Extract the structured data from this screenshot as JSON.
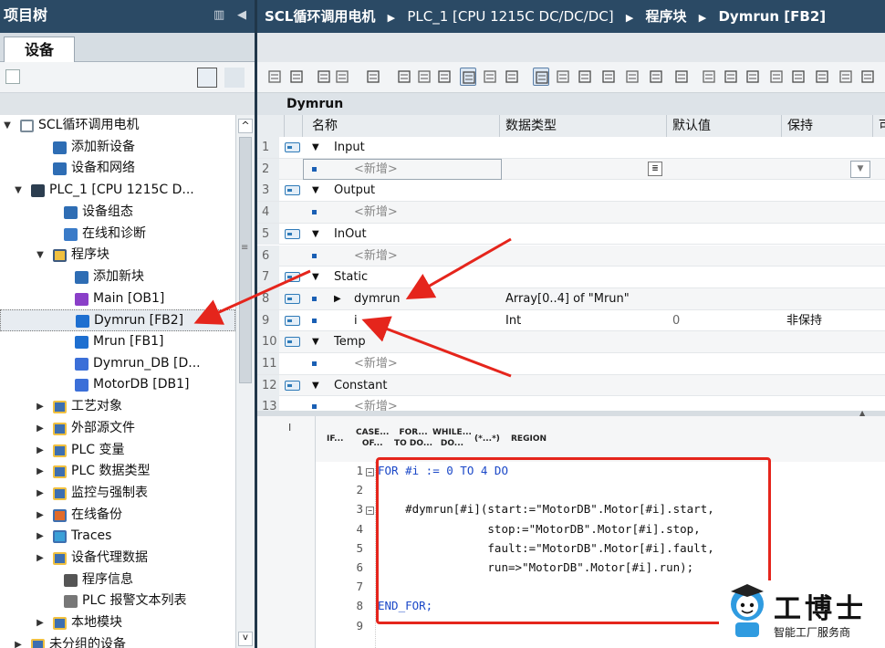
{
  "project_tree": {
    "title": "项目树",
    "tab": "设备",
    "items": [
      {
        "label": "SCL循环调用电机",
        "toggle": "▼"
      },
      {
        "label": "添加新设备",
        "toggle": ""
      },
      {
        "label": "设备和网络",
        "toggle": ""
      },
      {
        "label": "PLC_1 [CPU 1215C D...",
        "toggle": "▼"
      },
      {
        "label": "设备组态",
        "toggle": ""
      },
      {
        "label": "在线和诊断",
        "toggle": ""
      },
      {
        "label": "程序块",
        "toggle": "▼"
      },
      {
        "label": "添加新块",
        "toggle": ""
      },
      {
        "label": "Main [OB1]",
        "toggle": ""
      },
      {
        "label": "Dymrun [FB2]",
        "toggle": ""
      },
      {
        "label": "Mrun [FB1]",
        "toggle": ""
      },
      {
        "label": "Dymrun_DB [D...",
        "toggle": ""
      },
      {
        "label": "MotorDB [DB1]",
        "toggle": ""
      },
      {
        "label": "工艺对象",
        "toggle": "▶"
      },
      {
        "label": "外部源文件",
        "toggle": "▶"
      },
      {
        "label": "PLC 变量",
        "toggle": "▶"
      },
      {
        "label": "PLC 数据类型",
        "toggle": "▶"
      },
      {
        "label": "监控与强制表",
        "toggle": "▶"
      },
      {
        "label": "在线备份",
        "toggle": "▶"
      },
      {
        "label": "Traces",
        "toggle": "▶"
      },
      {
        "label": "设备代理数据",
        "toggle": "▶"
      },
      {
        "label": "程序信息",
        "toggle": ""
      },
      {
        "label": "PLC 报警文本列表",
        "toggle": ""
      },
      {
        "label": "本地模块",
        "toggle": "▶"
      },
      {
        "label": "未分组的设备",
        "toggle": "▶"
      }
    ]
  },
  "breadcrumb": [
    "SCL循环调用电机",
    "PLC_1 [CPU 1215C DC/DC/DC]",
    "程序块",
    "Dymrun [FB2]"
  ],
  "block_name": "Dymrun",
  "table": {
    "headers": [
      "名称",
      "数据类型",
      "默认值",
      "保持",
      "可"
    ],
    "rows": [
      {
        "n": "1",
        "name": "Input",
        "type": "",
        "default": "",
        "retain": "",
        "kind": "section"
      },
      {
        "n": "2",
        "name": "<新增>",
        "type": "",
        "default": "",
        "retain": "",
        "kind": "add"
      },
      {
        "n": "3",
        "name": "Output",
        "type": "",
        "default": "",
        "retain": "",
        "kind": "section"
      },
      {
        "n": "4",
        "name": "<新增>",
        "type": "",
        "default": "",
        "retain": "",
        "kind": "add"
      },
      {
        "n": "5",
        "name": "InOut",
        "type": "",
        "default": "",
        "retain": "",
        "kind": "section"
      },
      {
        "n": "6",
        "name": "<新增>",
        "type": "",
        "default": "",
        "retain": "",
        "kind": "add"
      },
      {
        "n": "7",
        "name": "Static",
        "type": "",
        "default": "",
        "retain": "",
        "kind": "section"
      },
      {
        "n": "8",
        "name": "dymrun",
        "type": "Array[0..4] of \"Mrun\"",
        "default": "",
        "retain": "",
        "kind": "array"
      },
      {
        "n": "9",
        "name": "i",
        "type": "Int",
        "default": "0",
        "retain": "非保持",
        "kind": "var"
      },
      {
        "n": "10",
        "name": "Temp",
        "type": "",
        "default": "",
        "retain": "",
        "kind": "section"
      },
      {
        "n": "11",
        "name": "<新增>",
        "type": "",
        "default": "",
        "retain": "",
        "kind": "add"
      },
      {
        "n": "12",
        "name": "Constant",
        "type": "",
        "default": "",
        "retain": "",
        "kind": "section"
      },
      {
        "n": "13",
        "name": "<新增>",
        "type": "",
        "default": "",
        "retain": "",
        "kind": "add"
      }
    ]
  },
  "snippets": [
    {
      "l1": "IF...",
      "l2": ""
    },
    {
      "l1": "CASE...",
      "l2": "OF..."
    },
    {
      "l1": "FOR...",
      "l2": "TO DO..."
    },
    {
      "l1": "WHILE...",
      "l2": "DO..."
    },
    {
      "l1": "(*...*)",
      "l2": ""
    },
    {
      "l1": "REGION",
      "l2": ""
    }
  ],
  "code_lines": [
    {
      "n": "1",
      "text": "FOR #i := 0 TO 4 DO"
    },
    {
      "n": "2",
      "text": ""
    },
    {
      "n": "3",
      "text": "    #dymrun[#i](start:=\"MotorDB\".Motor[#i].start,"
    },
    {
      "n": "4",
      "text": "                stop:=\"MotorDB\".Motor[#i].stop,"
    },
    {
      "n": "5",
      "text": "                fault:=\"MotorDB\".Motor[#i].fault,"
    },
    {
      "n": "6",
      "text": "                run=>\"MotorDB\".Motor[#i].run);"
    },
    {
      "n": "7",
      "text": ""
    },
    {
      "n": "8",
      "text": "END_FOR;"
    },
    {
      "n": "9",
      "text": ""
    }
  ],
  "watermark": {
    "name": "工博士",
    "tagline": "智能工厂服务商"
  },
  "colors": {
    "titlebar": "#2b4a65",
    "annotation_red": "#e5251c",
    "keyword_blue": "#1b48c8"
  }
}
